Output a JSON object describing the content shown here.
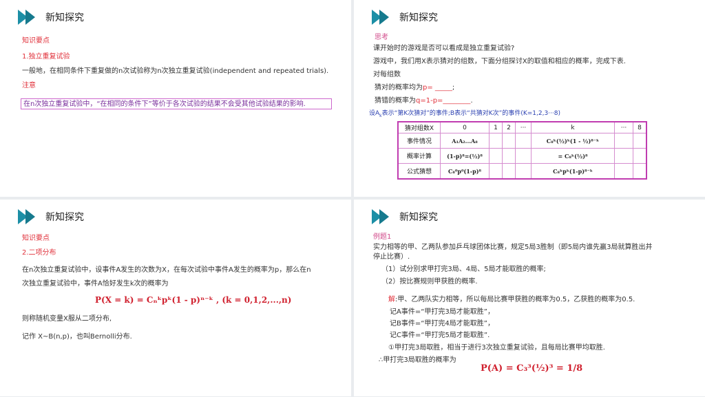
{
  "slides": {
    "s1": {
      "title": "新知探究",
      "kp": "知识要点",
      "heading": "1.独立重复试验",
      "body": "一般地，在相同条件下重复做的n次试验称为n次独立重复试验(independent and repeated trials).",
      "note_label": "注意",
      "note": "在n次独立重复试验中，“在相同的条件下”等价于各次试验的结果不会受其他试验结果的影响."
    },
    "s2": {
      "title": "新知探究",
      "think": "思考",
      "l1": "课开始时的游戏是否可以看成是独立重复试验?",
      "l2": "游戏中，我们用X表示猜对的组数，下面分组探讨X的取值和相应的概率，完成下表.",
      "l3": "对每组数",
      "l4a": "猜对的概率均为",
      "l4b": "p= _____",
      "l4c": ";",
      "l5a": "猜错的概率为",
      "l5b": "q=1-p=________",
      "l5c": ".",
      "l6": "设A",
      "l6sub": "k",
      "l6b": "表示“第K次猜对”的事件;B表示“共猜对K次”的事件(K=1,2,3···8)",
      "table": {
        "headers": [
          "猜对组数X",
          "0",
          "1",
          "2",
          "···",
          "k",
          "···",
          "8"
        ],
        "rows": [
          {
            "label": "事件情况",
            "c0": "A₁A₂...A₈",
            "ck": "C₈ᵏ(½)ᵏ(1 - ½)⁸⁻ᵏ"
          },
          {
            "label": "概率计算",
            "c0": "(1-p)⁸=(½)⁸",
            "ck": "= C₈ᵏ(½)⁸"
          },
          {
            "label": "公式猜想",
            "c0": "C₈⁰p⁰(1-p)⁸",
            "ck": "C₈ᵏpᵏ(1-p)⁸⁻ᵏ"
          }
        ]
      }
    },
    "s3": {
      "title": "新知探究",
      "kp": "知识要点",
      "heading": "2.二项分布",
      "p1": "在n次独立重复试验中，设事件A发生的次数为X，在每次试验中事件A发生的概率为p，那么在n",
      "p2": "次独立重复试验中，事件A恰好发生k次的概率为",
      "formula": "P(X = k) = Cₙᵏpᵏ(1 - p)ⁿ⁻ᵏ , (k = 0,1,2,...,n)",
      "p3": "则称随机变量X服从二项分布,",
      "p4": "记作 X~B(n,p)，也叫Bernolli分布."
    },
    "s4": {
      "title": "新知探究",
      "ex": "例题1",
      "q1": "实力相等的甲、乙两队参加乒乓球团体比赛，规定5局3胜制（即5局内谁先赢3局就算胜出并",
      "q2": "停止比赛）.",
      "q3": "（1）试分别求甲打完3局、4局、5局才能取胜的概率;",
      "q4": "（2）按比赛规则甲获胜的概率.",
      "sol_label": "解",
      "sol": ":甲、乙两队实力相等，所以每局比赛甲获胜的概率为0.5，乙获胜的概率为0.5.",
      "a": "记A事件=“甲打完3局才能取胜”，",
      "b": "记B事件=“甲打完4局才能取胜”，",
      "c": "记C事件=“甲打完5局才能取胜”.",
      "d": "①甲打完3局取胜，相当于进行3次独立重复试验，且每局比赛甲均取胜.",
      "e": "∴甲打完3局取胜的概率为",
      "formula": "P(A) = C₃³(½)³ = 1/8"
    }
  }
}
